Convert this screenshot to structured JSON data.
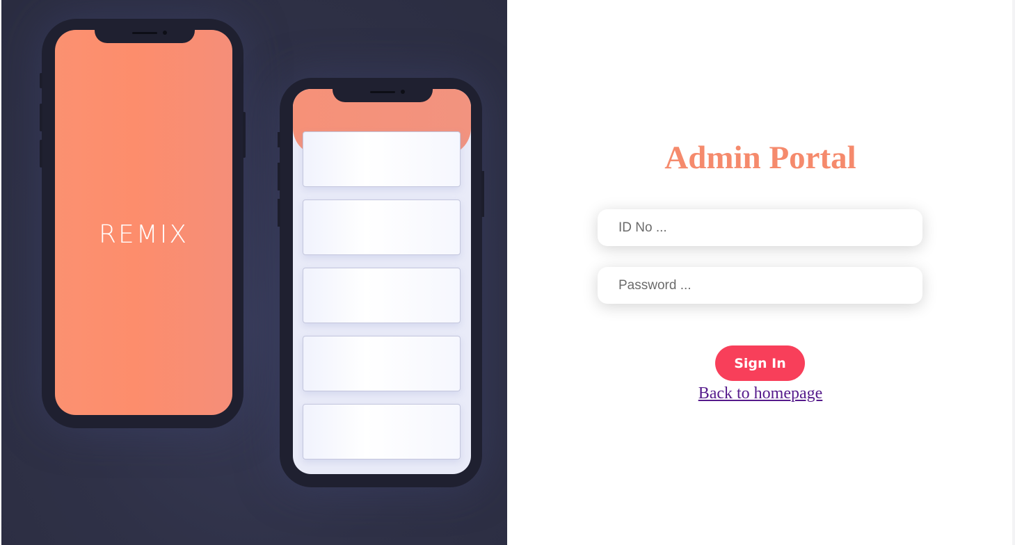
{
  "illustration": {
    "logo_text": "REMIX",
    "colors": {
      "background": "#2f3147",
      "phone_body": "#1f2030",
      "screen_accent": "#fd8d6c"
    }
  },
  "login": {
    "title": "Admin Portal",
    "id_placeholder": "ID No ...",
    "password_placeholder": "Password ...",
    "signin_label": "Sign In",
    "back_link": "Back to homepage"
  },
  "colors": {
    "title": "#f58a6c",
    "signin_button": "#f83f5a",
    "link_visited": "#551a8b"
  }
}
